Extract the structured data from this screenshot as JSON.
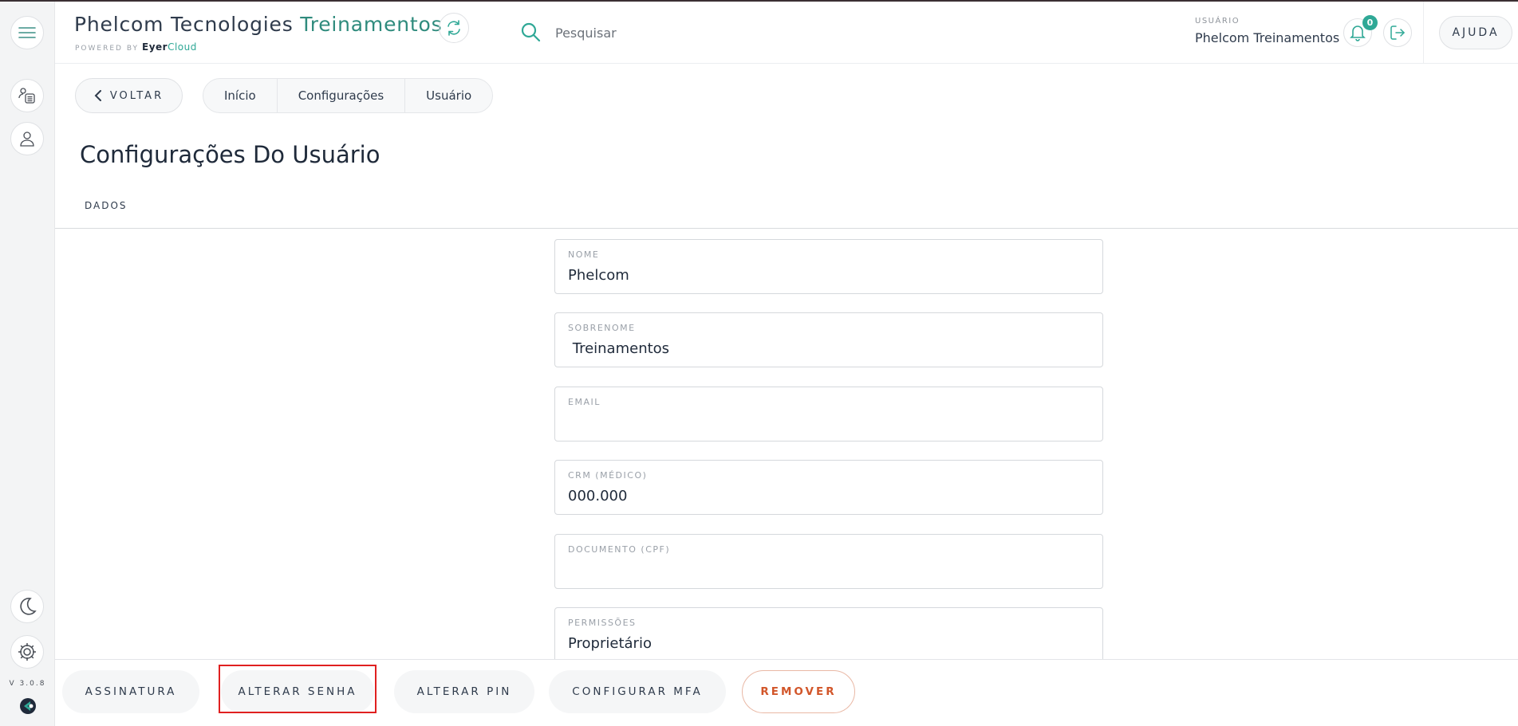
{
  "app": {
    "title_part1": "Phelcom Tecnologies",
    "title_part2": "Treinamentos",
    "powered_by": "POWERED BY",
    "powered_brand_1": "Eyer",
    "powered_brand_2": "Cloud",
    "version": "V 3.0.8"
  },
  "header": {
    "search_placeholder": "Pesquisar",
    "user_label": "USUÁRIO",
    "user_name": "Phelcom Treinamentos",
    "notification_count": "0",
    "help_label": "AJUDA"
  },
  "nav": {
    "back_label": "VOLTAR",
    "breadcrumb": [
      "Início",
      "Configurações",
      "Usuário"
    ]
  },
  "page": {
    "title": "Configurações Do Usuário",
    "tab": "DADOS"
  },
  "form": {
    "nome": {
      "label": "NOME",
      "value": "Phelcom"
    },
    "sobrenome": {
      "label": "SOBRENOME",
      "value": " Treinamentos"
    },
    "email": {
      "label": "EMAIL",
      "value": ""
    },
    "crm": {
      "label": "CRM (MÉDICO)",
      "value": "000.000"
    },
    "documento": {
      "label": "DOCUMENTO (CPF)",
      "value": ""
    },
    "permissoes": {
      "label": "PERMISSÕES",
      "value": "Proprietário"
    }
  },
  "actions": {
    "assinatura": "ASSINATURA",
    "alterar_senha": "ALTERAR SENHA",
    "alterar_pin": "ALTERAR PIN",
    "configurar_mfa": "CONFIGURAR MFA",
    "remover": "REMOVER"
  },
  "icons": {
    "menu": "hamburger-menu-icon",
    "list": "user-list-icon",
    "user": "user-icon",
    "moon": "moon-icon",
    "gear": "gear-icon",
    "sync": "sync-icon",
    "search": "search-icon",
    "bell": "bell-icon",
    "logout": "logout-icon",
    "back": "chevron-left-icon"
  },
  "colors": {
    "accent": "#2fa896",
    "title_accent": "#2f8b7d",
    "danger": "#d2562a",
    "highlight": "#e02020"
  }
}
